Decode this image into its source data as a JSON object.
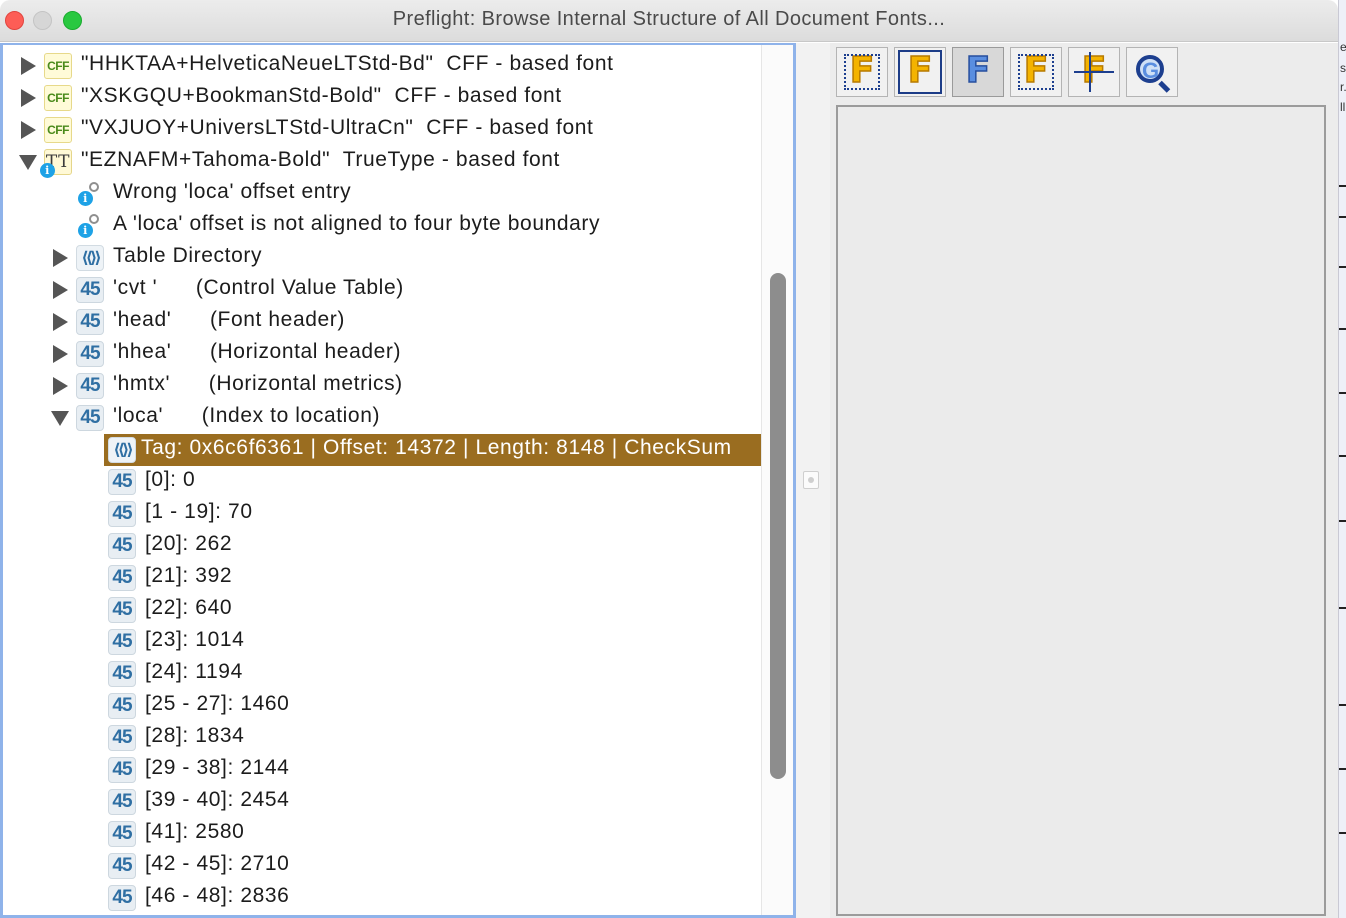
{
  "window": {
    "title": "Preflight: Browse Internal Structure of All Document Fonts..."
  },
  "colors": {
    "selection": "#9a6d20",
    "focus_border": "#8fb3ea",
    "number_icon": "#2f6fa3"
  },
  "tree": {
    "rows": [
      {
        "icon": "cff-font-icon",
        "icon_text": "CFF",
        "toggle": "collapsed",
        "label": "\"HHKTAA+HelveticaNeueLTStd-Bd\"  CFF - based font"
      },
      {
        "icon": "cff-font-icon",
        "icon_text": "CFF",
        "toggle": "collapsed",
        "label": "\"XSKGQU+BookmanStd-Bold\"  CFF - based font"
      },
      {
        "icon": "cff-font-icon",
        "icon_text": "CFF",
        "toggle": "collapsed",
        "label": "\"VXJUOY+UniversLTStd-UltraCn\"  CFF - based font"
      },
      {
        "icon": "truetype-font-icon",
        "icon_text": "TT",
        "toggle": "expanded",
        "label": "\"EZNAFM+Tahoma-Bold\"  TrueType - based font"
      },
      {
        "icon": "info-icon",
        "icon_text": "i",
        "toggle": "none",
        "label": "Wrong 'loca' offset entry"
      },
      {
        "icon": "info-icon",
        "icon_text": "i",
        "toggle": "none",
        "label": "A 'loca' offset is not aligned to four byte boundary"
      },
      {
        "icon": "structure-icon",
        "icon_text": "⟨⟨⟩⟩",
        "toggle": "collapsed",
        "label": "Table Directory"
      },
      {
        "icon": "number-icon",
        "icon_text": "45",
        "toggle": "collapsed",
        "label": "'cvt '      (Control Value Table)"
      },
      {
        "icon": "number-icon",
        "icon_text": "45",
        "toggle": "collapsed",
        "label": "'head'      (Font header)"
      },
      {
        "icon": "number-icon",
        "icon_text": "45",
        "toggle": "collapsed",
        "label": "'hhea'      (Horizontal header)"
      },
      {
        "icon": "number-icon",
        "icon_text": "45",
        "toggle": "collapsed",
        "label": "'hmtx'      (Horizontal metrics)"
      },
      {
        "icon": "number-icon",
        "icon_text": "45",
        "toggle": "expanded",
        "label": "'loca'      (Index to location)"
      },
      {
        "icon": "structure-icon",
        "icon_text": "⟨⟨⟩⟩",
        "toggle": "none",
        "selected": true,
        "label": "Tag: 0x6c6f6361 | Offset: 14372 | Length: 8148 | CheckSum"
      },
      {
        "icon": "number-icon",
        "icon_text": "45",
        "toggle": "none",
        "label": "[0]: 0"
      },
      {
        "icon": "number-icon",
        "icon_text": "45",
        "toggle": "none",
        "label": "[1 - 19]: 70"
      },
      {
        "icon": "number-icon",
        "icon_text": "45",
        "toggle": "none",
        "label": "[20]: 262"
      },
      {
        "icon": "number-icon",
        "icon_text": "45",
        "toggle": "none",
        "label": "[21]: 392"
      },
      {
        "icon": "number-icon",
        "icon_text": "45",
        "toggle": "none",
        "label": "[22]: 640"
      },
      {
        "icon": "number-icon",
        "icon_text": "45",
        "toggle": "none",
        "label": "[23]: 1014"
      },
      {
        "icon": "number-icon",
        "icon_text": "45",
        "toggle": "none",
        "label": "[24]: 1194"
      },
      {
        "icon": "number-icon",
        "icon_text": "45",
        "toggle": "none",
        "label": "[25 - 27]: 1460"
      },
      {
        "icon": "number-icon",
        "icon_text": "45",
        "toggle": "none",
        "label": "[28]: 1834"
      },
      {
        "icon": "number-icon",
        "icon_text": "45",
        "toggle": "none",
        "label": "[29 - 38]: 2144"
      },
      {
        "icon": "number-icon",
        "icon_text": "45",
        "toggle": "none",
        "label": "[39 - 40]: 2454"
      },
      {
        "icon": "number-icon",
        "icon_text": "45",
        "toggle": "none",
        "label": "[41]: 2580"
      },
      {
        "icon": "number-icon",
        "icon_text": "45",
        "toggle": "none",
        "label": "[42 - 45]: 2710"
      },
      {
        "icon": "number-icon",
        "icon_text": "45",
        "toggle": "none",
        "label": "[46 - 48]: 2836"
      }
    ]
  },
  "toolbar": {
    "buttons": [
      {
        "name": "font-bounding-box-icon",
        "glyph": "F"
      },
      {
        "name": "font-frame-icon",
        "glyph": "F"
      },
      {
        "name": "font-outline-icon",
        "glyph": "F"
      },
      {
        "name": "font-points-icon",
        "glyph": "F"
      },
      {
        "name": "font-baseline-icon",
        "glyph": "F"
      },
      {
        "name": "zoom-glyph-icon",
        "glyph": "G"
      }
    ]
  },
  "edge_strip": {
    "fragments": [
      "e",
      "s",
      "r.",
      "ll"
    ]
  }
}
